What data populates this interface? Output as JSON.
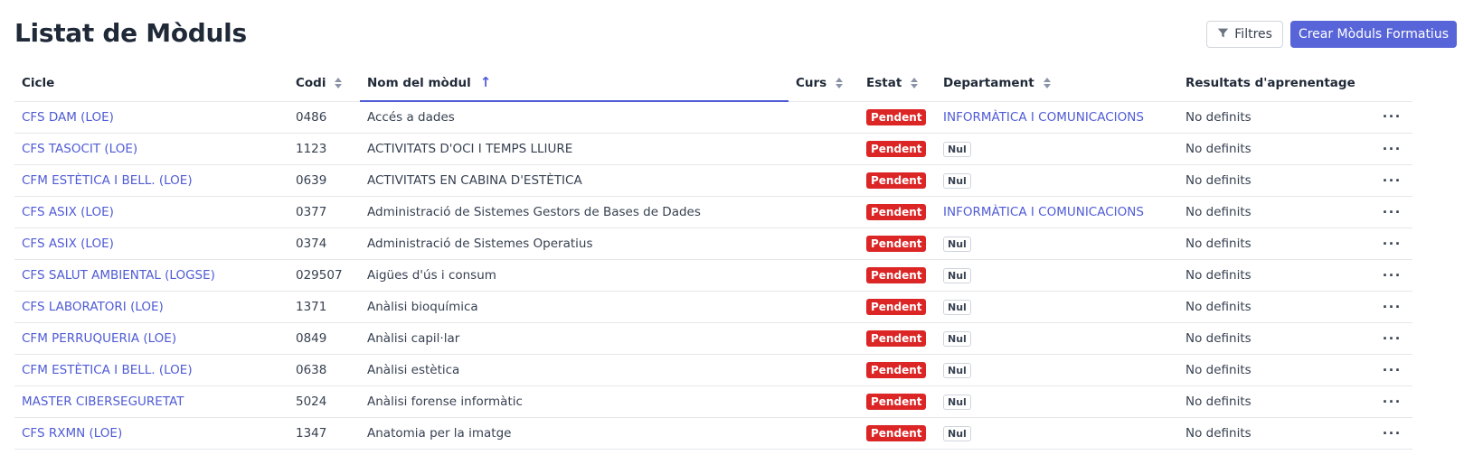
{
  "page": {
    "title": "Listat de Mòduls"
  },
  "toolbar": {
    "filter_label": "Filtres",
    "filter_icon": "funnel-icon",
    "create_label": "Crear Mòduls Formatius"
  },
  "colors": {
    "accent": "#5865d8",
    "link": "#4f5bd5",
    "danger": "#dc2626"
  },
  "table": {
    "columns": [
      {
        "label": "Cicle"
      },
      {
        "label": "Codi"
      },
      {
        "label": "Nom del mòdul"
      },
      {
        "label": "Curs"
      },
      {
        "label": "Estat"
      },
      {
        "label": "Departament"
      },
      {
        "label": "Resultats d'aprenentage"
      }
    ],
    "rows": [
      {
        "cicle": "CFS DAM (LOE)",
        "codi": "0486",
        "nom": "Accés a dades",
        "curs": "",
        "estat": "Pendent",
        "departament": "INFORMÀTICA I COMUNICACIONS",
        "resultats": "No definits"
      },
      {
        "cicle": "CFS TASOCIT (LOE)",
        "codi": "1123",
        "nom": "ACTIVITATS D'OCI I TEMPS LLIURE",
        "curs": "",
        "estat": "Pendent",
        "departament": "Nul",
        "resultats": "No definits"
      },
      {
        "cicle": "CFM ESTÈTICA I BELL. (LOE)",
        "codi": "0639",
        "nom": "ACTIVITATS EN CABINA D'ESTÈTICA",
        "curs": "",
        "estat": "Pendent",
        "departament": "Nul",
        "resultats": "No definits"
      },
      {
        "cicle": "CFS ASIX (LOE)",
        "codi": "0377",
        "nom": "Administració de Sistemes Gestors de Bases de Dades",
        "curs": "",
        "estat": "Pendent",
        "departament": "INFORMÀTICA I COMUNICACIONS",
        "resultats": "No definits"
      },
      {
        "cicle": "CFS ASIX (LOE)",
        "codi": "0374",
        "nom": "Administració de Sistemes Operatius",
        "curs": "",
        "estat": "Pendent",
        "departament": "Nul",
        "resultats": "No definits"
      },
      {
        "cicle": "CFS SALUT AMBIENTAL (LOGSE)",
        "codi": "029507",
        "nom": "Aigües d'ús i consum",
        "curs": "",
        "estat": "Pendent",
        "departament": "Nul",
        "resultats": "No definits"
      },
      {
        "cicle": "CFS LABORATORI (LOE)",
        "codi": "1371",
        "nom": "Anàlisi bioquímica",
        "curs": "",
        "estat": "Pendent",
        "departament": "Nul",
        "resultats": "No definits"
      },
      {
        "cicle": "CFM PERRUQUERIA (LOE)",
        "codi": "0849",
        "nom": "Anàlisi capil·lar",
        "curs": "",
        "estat": "Pendent",
        "departament": "Nul",
        "resultats": "No definits"
      },
      {
        "cicle": "CFM ESTÈTICA I BELL. (LOE)",
        "codi": "0638",
        "nom": "Anàlisi estètica",
        "curs": "",
        "estat": "Pendent",
        "departament": "Nul",
        "resultats": "No definits"
      },
      {
        "cicle": "MASTER CIBERSEGURETAT",
        "codi": "5024",
        "nom": "Anàlisi forense informàtic",
        "curs": "",
        "estat": "Pendent",
        "departament": "Nul",
        "resultats": "No definits"
      },
      {
        "cicle": "CFS RXMN (LOE)",
        "codi": "1347",
        "nom": "Anatomia per la imatge",
        "curs": "",
        "estat": "Pendent",
        "departament": "Nul",
        "resultats": "No definits"
      }
    ]
  }
}
